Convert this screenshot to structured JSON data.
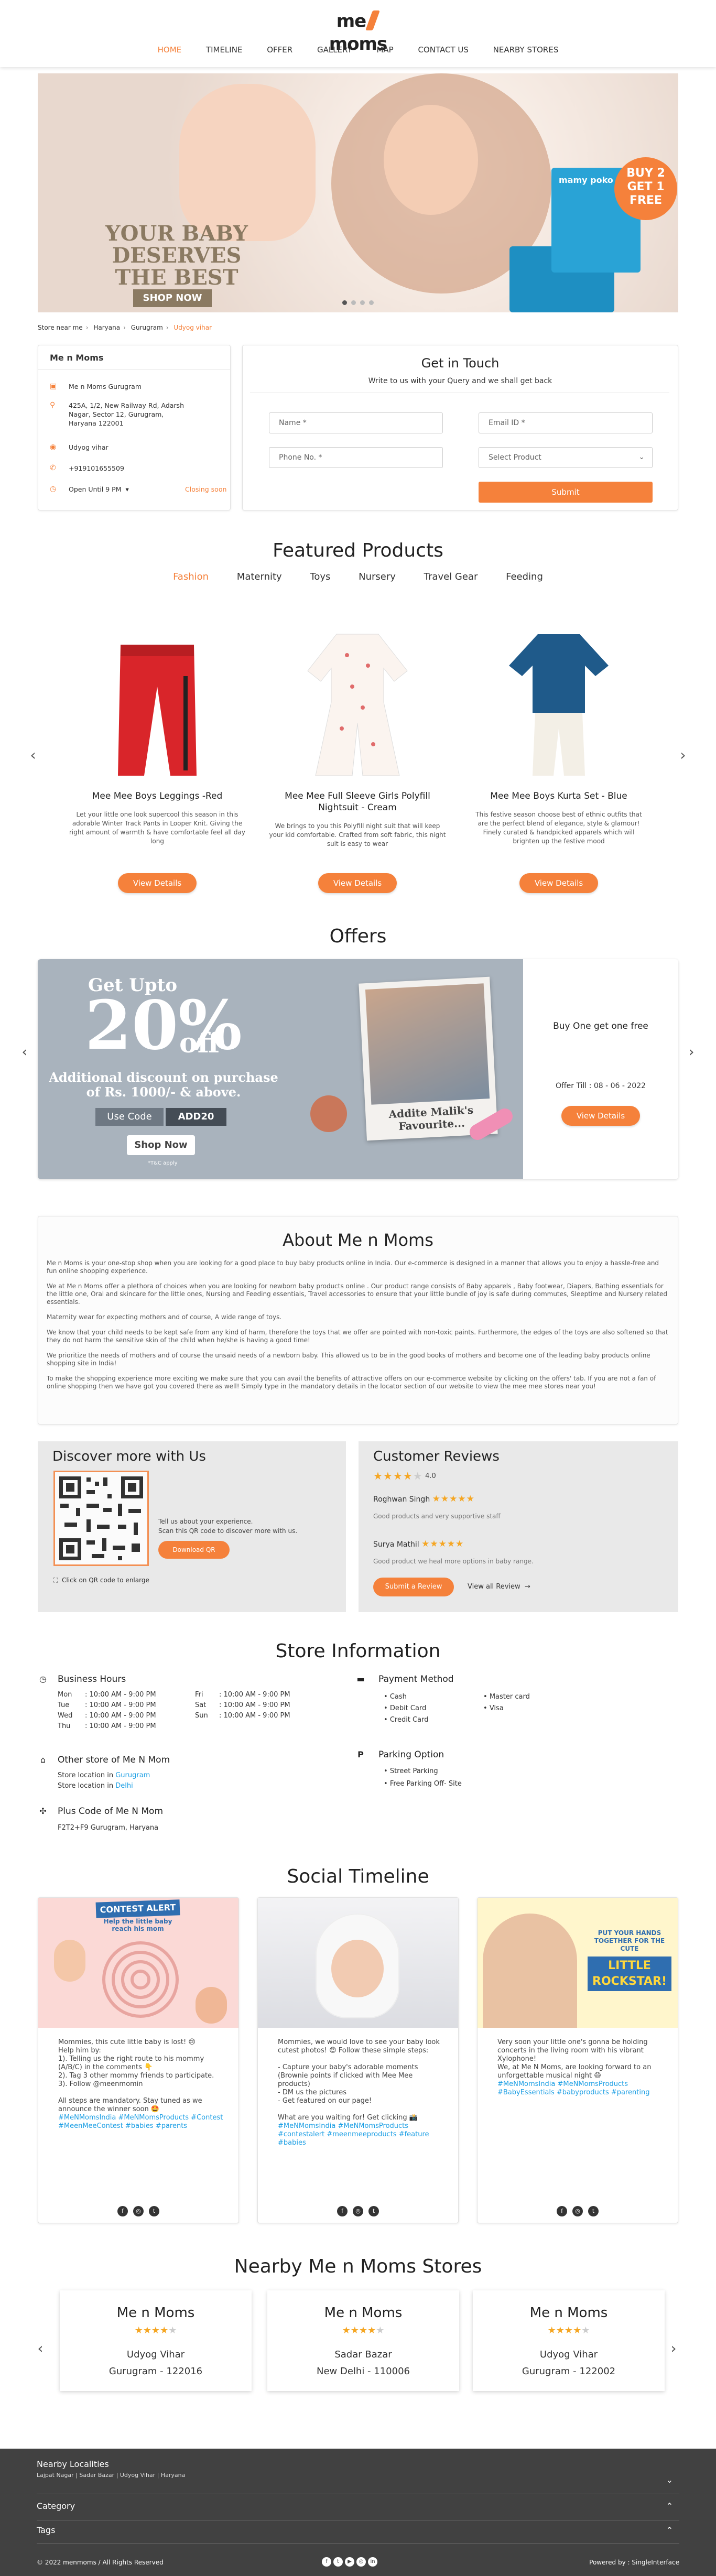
{
  "brand": {
    "logo_left": "me",
    "logo_right": "moms",
    "accent": "#f5813b"
  },
  "nav": [
    "HOME",
    "TIMELINE",
    "OFFER",
    "GALLERY",
    "MAP",
    "CONTACT US",
    "NEARBY STORES"
  ],
  "banner": {
    "headline": "YOUR BABY DESERVES THE BEST",
    "cta": "SHOP NOW",
    "badge": "BUY 2 GET 1 FREE",
    "box_brand": "mamy poko"
  },
  "breadcrumb": [
    "Store near me",
    "Haryana",
    "Gurugram",
    "Udyog vihar"
  ],
  "store": {
    "name": "Me n Moms",
    "branch": "Me n Moms Gurugram",
    "address": "425A, 1/2, New Railway Rd, Adarsh Nagar, Sector 12, Gurugram, Haryana 122001",
    "locality": "Udyog vihar",
    "phone": "+919101655509",
    "hours": "Open Until 9 PM",
    "closing": "Closing soon"
  },
  "touch": {
    "title": "Get in Touch",
    "subtitle": "Write to us with your Query and we shall get back",
    "name_ph": "Name *",
    "email_ph": "Email ID *",
    "phone_ph": "Phone No. *",
    "product_ph": "Select Product",
    "submit": "Submit"
  },
  "featured": {
    "title": "Featured Products",
    "categories": [
      "Fashion",
      "Maternity",
      "Toys",
      "Nursery",
      "Travel Gear",
      "Feeding"
    ],
    "products": [
      {
        "name": "Mee Mee Boys Leggings -Red",
        "desc": "Let your little one look supercool this season in this adorable Winter Track Pants in Looper Knit. Giving the right amount of warmth & have comfortable feel all day long",
        "cta": "View Details"
      },
      {
        "name": "Mee Mee Full Sleeve Girls Polyfill Nightsuit - Cream",
        "desc": "We brings to you this Polyfill night suit that will keep your kid comfortable. Crafted from soft fabric, this night suit is easy to wear",
        "cta": "View Details"
      },
      {
        "name": "Mee Mee Boys Kurta Set - Blue",
        "desc": "This festive season choose best of ethnic outfits that are the perfect blend of elegance, style & glamour! Finely curated & handpicked apparels which will brighten up the festive mood",
        "cta": "View Details"
      }
    ]
  },
  "offers": {
    "title": "Offers",
    "img_upto": "Get Upto",
    "img_pct": "20%",
    "img_off": "off",
    "img_additional": "Additional discount on purchase of Rs. 1000/- & above.",
    "img_usecode": "Use Code",
    "img_code": "ADD20",
    "img_shop": "Shop Now",
    "img_tnc": "*T&C apply",
    "img_caption": "Addite Malik's Favourite...",
    "offer_name": "Buy One get one free",
    "offer_till": "Offer Till : 08 - 06 - 2022",
    "cta": "View Details"
  },
  "about": {
    "title": "About  Me n Moms",
    "paras": [
      "Me n Moms is your one-stop shop when you are looking for a good place to buy baby products online in India. Our e-commerce is designed in a manner that allows you to enjoy a hassle-free and fun online shopping experience.",
      "We at Me n Moms offer a plethora of choices when you are looking for newborn baby products online . Our product range consists of Baby apparels , Baby footwear, Diapers, Bathing essentials for the little one, Oral and skincare for the little ones, Nursing and Feeding essentials, Travel accessories to ensure that your little bundle of joy is safe during commutes, Sleeptime and Nursery related essentials.",
      "Maternity wear for expecting mothers and of course, A wide range of toys.",
      "We know that your child needs to be kept safe from any kind of harm, therefore the toys that we offer are pointed with non-toxic paints. Furthermore, the edges of the toys are also softened so that they do not harm the sensitive skin of the child when he/she is having a good time!",
      "We prioritize the needs of mothers and of course the unsaid needs of a newborn baby. This allowed us to be in the good books of mothers and become one of the leading baby products online shopping site in India!",
      "To make the shopping experience more exciting we make sure that you can avail the benefits of attractive offers on our e-commerce website by clicking on the offers' tab. If you are not a fan of online shopping then we have got you covered there as well! Simply type in the mandatory details in the locator section of our website to view the mee mee stores near you!"
    ]
  },
  "discover": {
    "title": "Discover more with Us",
    "line1": "Tell us about your experience.",
    "line2": "Scan this QR code to discover more with us.",
    "download": "Download QR",
    "enlarge": "Click on QR code to enlarge"
  },
  "reviews": {
    "title": "Customer Reviews",
    "rating": 4.0,
    "rating_text": "4.0",
    "items": [
      {
        "name": "Roghwan Singh",
        "text": "Good products and very supportive staff"
      },
      {
        "name": "Surya Mathil",
        "text": "Good product we heal more options in baby range."
      }
    ],
    "submit": "Submit a Review",
    "viewall": "View all Review"
  },
  "info": {
    "title": "Store Information",
    "hours_title": "Business Hours",
    "hours": [
      {
        "d": "Mon",
        "t": ": 10:00 AM - 9:00 PM"
      },
      {
        "d": "Tue",
        "t": ": 10:00 AM - 9:00 PM"
      },
      {
        "d": "Wed",
        "t": ": 10:00 AM - 9:00 PM"
      },
      {
        "d": "Thu",
        "t": ": 10:00 AM - 9:00 PM"
      },
      {
        "d": "Fri",
        "t": ": 10:00 AM - 9:00 PM"
      },
      {
        "d": "Sat",
        "t": ": 10:00 AM - 9:00 PM"
      },
      {
        "d": "Sun",
        "t": ": 10:00 AM - 9:00 PM"
      }
    ],
    "other_title": "Other store of Me N Mom",
    "other_1_pre": "Store location in ",
    "other_1_link": "Gurugram",
    "other_2_pre": "Store location in ",
    "other_2_link": "Delhi",
    "plus_title": "Plus Code of Me N Mom",
    "plus_code": "F2T2+F9 Gurugram, Haryana",
    "pay_title": "Payment Method",
    "pay": [
      "Cash",
      "Master card",
      "Debit Card",
      "Visa",
      "Credit Card"
    ],
    "park_title": "Parking Option",
    "park": [
      "Street Parking",
      "Free Parking Off- Site"
    ]
  },
  "social": {
    "title": "Social Timeline",
    "posts": [
      {
        "img_title": "CONTEST ALERT",
        "img_sub": "Help the little baby reach his mom",
        "text": "Mommies, this cute little baby is lost! 😢\nHelp him by:\n1). Telling us the right route to his mommy (A/B/C) in the comments 👇\n2). Tag 3 other mommy friends to participate.\n3). Follow @meenmomin\n\nAll steps are mandatory. Stay tuned as we announce the winner soon 🤩",
        "tags": "#MeNMomsIndia #MeNMomsProducts #Contest #MeenMeeContest #babies #parents"
      },
      {
        "img_title": "",
        "img_sub": "",
        "text": "Mommies, we would love to see your baby look cutest photos! 😍 Follow these simple steps:\n\n- Capture your baby's adorable moments (Brownie points if clicked with Mee Mee products)\n- DM us the pictures\n- Get featured on our page!\n\nWhat are you waiting for! Get clicking 📸",
        "tags": "#MeNMomsIndia #MeNMomsProducts #contestalert #meenmeeproducts #feature #babies"
      },
      {
        "img_title": "LITTLE ROCKSTAR!",
        "img_sub": "PUT YOUR HANDS TOGETHER FOR THE CUTE",
        "text": "Very soon your little one's gonna be holding concerts in the living room with his vibrant Xylophone!\nWe, at Me N Moms, are looking forward to an unforgettable musical night 😄",
        "tags": "#MeNMomsIndia #MeNMomsProducts #BabyEssentials #babyproducts #parenting"
      }
    ]
  },
  "nearby": {
    "title": "Nearby Me n Moms Stores",
    "stores": [
      {
        "name": "Me n Moms",
        "stars": 4,
        "area": "Udyog Vihar",
        "city": "Gurugram - 122016"
      },
      {
        "name": "Me n Moms",
        "stars": 4,
        "area": "Sadar Bazar",
        "city": "New Delhi - 110006"
      },
      {
        "name": "Me n Moms",
        "stars": 4,
        "area": "Udyog Vihar",
        "city": "Gurugram - 122002"
      }
    ]
  },
  "footer": {
    "localities_title": "Nearby Localities",
    "localities": "Lajpat Nagar  |  Sadar Bazar  |  Udyog Vihar  |  Haryana",
    "category": "Category",
    "tags": "Tags",
    "copyright": "© 2022 menmoms / All Rights Reserved",
    "powered": "Powered by : SingleInterface"
  }
}
